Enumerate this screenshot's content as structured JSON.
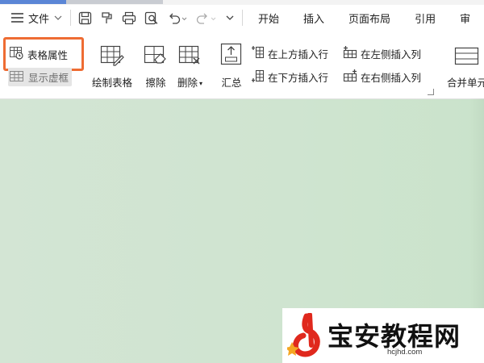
{
  "app": {
    "file_menu_label": "文件"
  },
  "menu_tabs": [
    {
      "label": "开始"
    },
    {
      "label": "插入"
    },
    {
      "label": "页面布局"
    },
    {
      "label": "引用"
    },
    {
      "label": "审"
    }
  ],
  "quick_access": [
    {
      "icon": "save-icon"
    },
    {
      "icon": "format-painter-icon"
    },
    {
      "icon": "print-icon"
    },
    {
      "icon": "print-preview-icon"
    },
    {
      "icon": "undo-icon"
    },
    {
      "icon": "redo-icon"
    },
    {
      "icon": "customize-dropdown-icon"
    }
  ],
  "tools": {
    "table_properties": "表格属性",
    "show_gridlines": "显示虚框",
    "draw_table": "绘制表格",
    "eraser": "擦除",
    "delete": "删除",
    "summary": "汇总",
    "insert_row_above": "在上方插入行",
    "insert_row_below": "在下方插入行",
    "insert_col_left": "在左侧插入列",
    "insert_col_right": "在右侧插入列",
    "merge_cells": "合并单元"
  },
  "watermark": {
    "name": "宝安教程网",
    "url": "hcjhd.com"
  },
  "colors": {
    "accent_highlight": "#ee6c33",
    "background_green": "#cfe4d0",
    "top_accent_blue": "#5b86d6",
    "watermark_red": "#e0281d"
  }
}
